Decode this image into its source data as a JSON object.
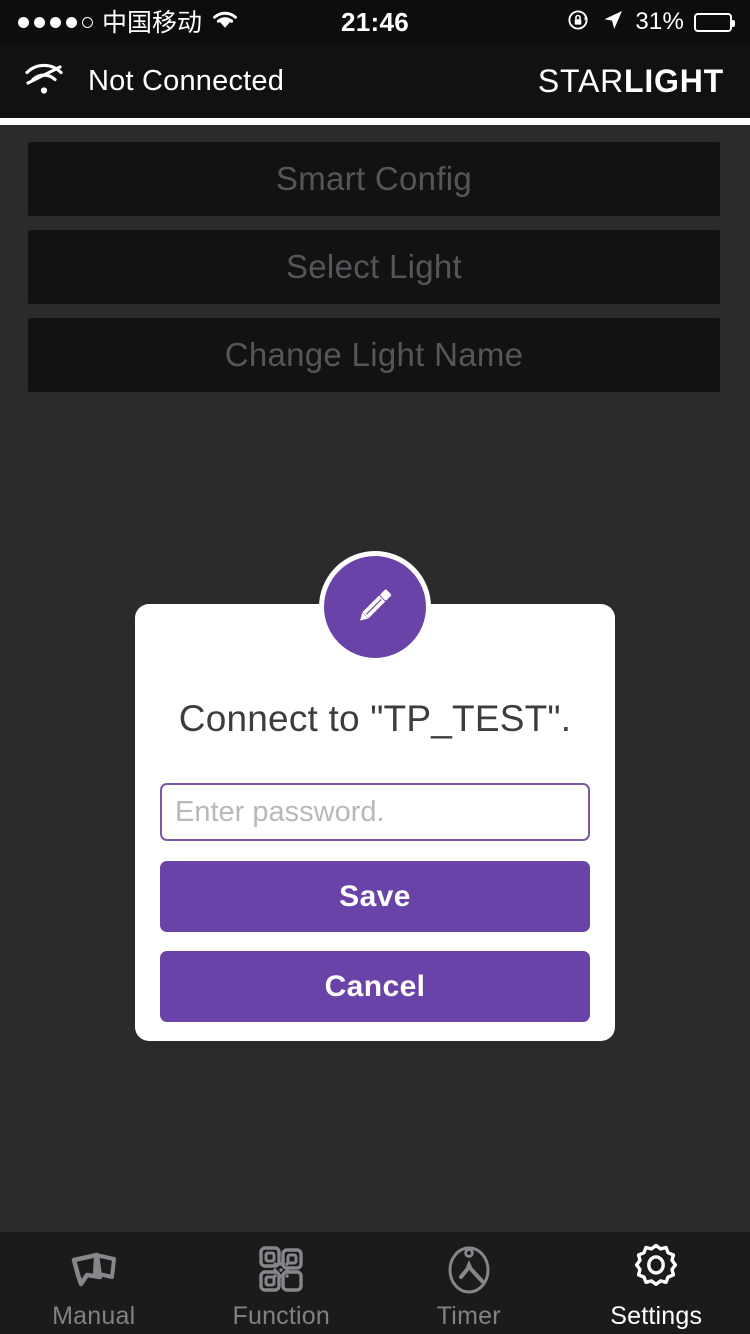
{
  "statusbar": {
    "signal_dots_filled": 4,
    "signal_dots_total": 5,
    "carrier": "中国移动",
    "wifi_icon": "wifi-icon",
    "time": "21:46",
    "rotation_lock_icon": "rotation-lock-icon",
    "location_icon": "location-arrow-icon",
    "battery_percent": "31%",
    "battery_level": 31
  },
  "appbar": {
    "wifi_off_icon": "wifi-off-icon",
    "connection_status": "Not Connected",
    "brand_thin": "STAR",
    "brand_bold": "LIGHT"
  },
  "main": {
    "buttons": [
      {
        "label": "Smart Config"
      },
      {
        "label": "Select Light"
      },
      {
        "label": "Change Light Name"
      }
    ]
  },
  "modal": {
    "icon": "pencil-icon",
    "title": "Connect to \"TP_TEST\".",
    "password_value": "",
    "password_placeholder": "Enter password.",
    "save_label": "Save",
    "cancel_label": "Cancel"
  },
  "tabbar": {
    "items": [
      {
        "label": "Manual",
        "icon": "manual-cards-icon",
        "active": false
      },
      {
        "label": "Function",
        "icon": "qr-code-icon",
        "active": false
      },
      {
        "label": "Timer",
        "icon": "timer-clock-icon",
        "active": false
      },
      {
        "label": "Settings",
        "icon": "gear-icon",
        "active": true
      }
    ]
  },
  "colors": {
    "accent_purple": "#6a43a8",
    "background": "#2b2b2d",
    "header_black": "#111111",
    "tabbar": "#1b1b1c",
    "disabled_text": "#55555a"
  }
}
